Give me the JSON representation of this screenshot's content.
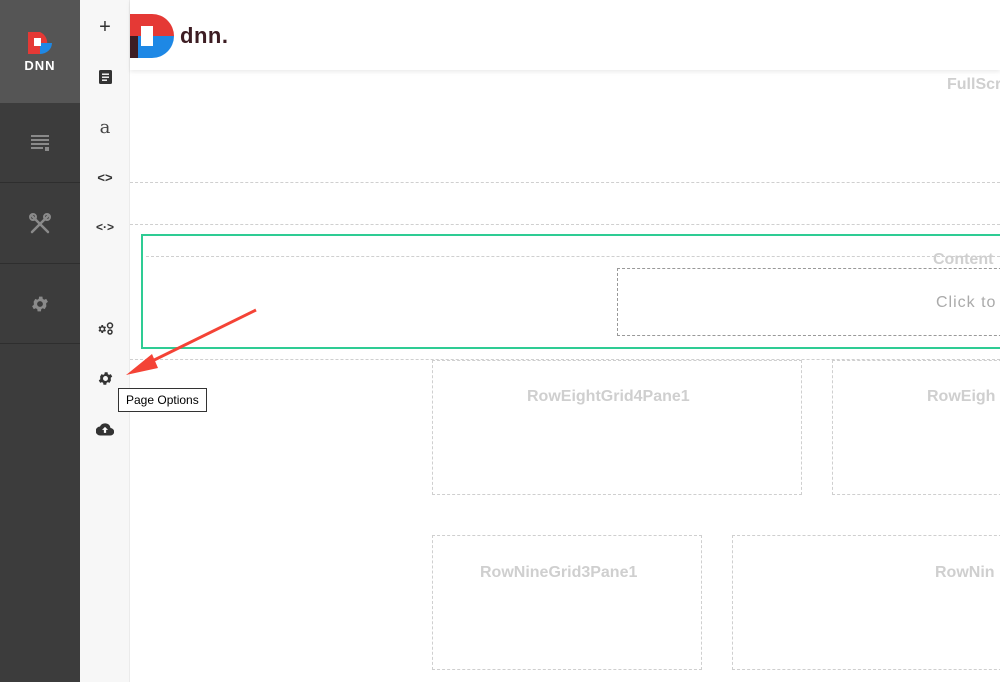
{
  "persona_bar": {
    "logo_text": "DNN",
    "items": [
      {
        "icon": "content-icon"
      },
      {
        "icon": "tools-icon"
      },
      {
        "icon": "settings-icon"
      }
    ]
  },
  "edit_bar": {
    "tools": [
      {
        "icon": "add-icon",
        "glyph": "+"
      },
      {
        "icon": "page-icon",
        "glyph": ""
      },
      {
        "icon": "text-icon",
        "glyph": "a"
      },
      {
        "icon": "code-icon",
        "glyph": "<>"
      },
      {
        "icon": "expand-icon",
        "glyph": "<·>"
      },
      {
        "icon": "gears-icon",
        "glyph": ""
      },
      {
        "icon": "gear-icon",
        "glyph": ""
      },
      {
        "icon": "cloud-upload-icon",
        "glyph": ""
      }
    ],
    "tooltip": "Page Options"
  },
  "header": {
    "brand_text": "dnn."
  },
  "panes": {
    "fullscreen_label": "FullScr",
    "content_label": "Content",
    "click_to_label": "Click to",
    "row_eight_1": "RowEightGrid4Pane1",
    "row_eight_2": "RowEigh",
    "row_nine_1": "RowNineGrid3Pane1",
    "row_nine_2": "RowNin"
  },
  "colors": {
    "persona_bg": "#3c3c3c",
    "logo_cell_bg": "#555555",
    "accent_red": "#e53935",
    "accent_blue": "#1e88e5",
    "brand_dark": "#3d1d23",
    "content_border": "#2ecc94",
    "arrow_red": "#f44336"
  }
}
